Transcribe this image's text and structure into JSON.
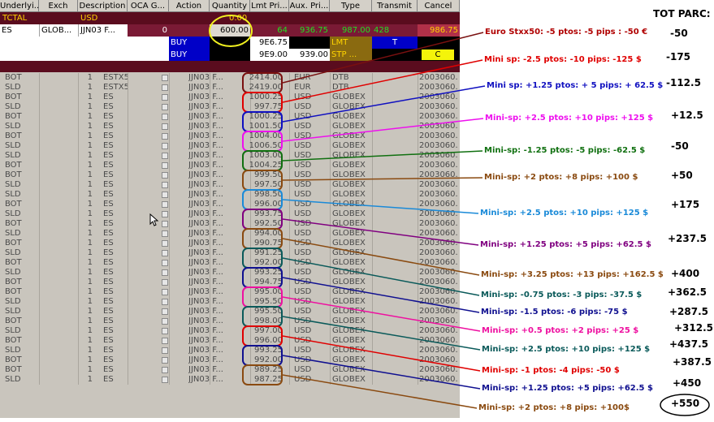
{
  "headers": [
    "Underlyi...",
    "Exch",
    "Description",
    "OCA G...",
    "Action",
    "Quantity",
    "Lmt Pri...",
    "Aux. Pri...",
    "Type",
    "Transmit",
    "Cancel"
  ],
  "total_row": {
    "label": "TCTAL",
    "currency": "USD",
    "value": "0.00"
  },
  "position_row": {
    "underlying": "ES",
    "exch": "GLOB...",
    "desc": "JJN03 F...",
    "oca": "0",
    "quantity": "600.00",
    "v1": "64",
    "v2": "936.75",
    "v3": "987.00",
    "v4": "428",
    "v5": "986.75"
  },
  "order_row_1": {
    "action": "BUY",
    "lmt": "9E6.75",
    "type": "LMT",
    "transmit": "T"
  },
  "order_row_2": {
    "action": "BUY",
    "lmt": "9E9.00",
    "aux": "939.00",
    "type": "STP ...",
    "cancel": "C"
  },
  "trades": [
    {
      "side": "BOT",
      "qty": "1",
      "sym": "ESTX50",
      "desc": "JJN03 F...",
      "price": "2414.00",
      "cur": "EUR",
      "type": "DTB",
      "date": "2003060..."
    },
    {
      "side": "SLD",
      "qty": "1",
      "sym": "ESTX50",
      "desc": "JJN03 F...",
      "price": "2419.00",
      "cur": "EUR",
      "type": "DTB",
      "date": "2003060..."
    },
    {
      "side": "BOT",
      "qty": "1",
      "sym": "ES",
      "desc": "JJN03 F...",
      "price": "1000.25",
      "cur": "USD",
      "type": "GLOBEX",
      "date": "2003060..."
    },
    {
      "side": "SLD",
      "qty": "1",
      "sym": "ES",
      "desc": "JJN03 F...",
      "price": "997.75",
      "cur": "USD",
      "type": "GLOBEX",
      "date": "2003060..."
    },
    {
      "side": "BOT",
      "qty": "1",
      "sym": "ES",
      "desc": "JJN03 F...",
      "price": "1000.25",
      "cur": "USD",
      "type": "GLOBEX",
      "date": "2003060..."
    },
    {
      "side": "SLD",
      "qty": "1",
      "sym": "ES",
      "desc": "JJN03 F...",
      "price": "1001.50",
      "cur": "USD",
      "type": "GLOBEX",
      "date": "2003060..."
    },
    {
      "side": "BOT",
      "qty": "1",
      "sym": "ES",
      "desc": "JJN03 F...",
      "price": "1004.00",
      "cur": "USD",
      "type": "GLOBEX",
      "date": "2003060..."
    },
    {
      "side": "SLD",
      "qty": "1",
      "sym": "ES",
      "desc": "JJN03 F...",
      "price": "1006.50",
      "cur": "USD",
      "type": "GLOBEX",
      "date": "2003060..."
    },
    {
      "side": "SLD",
      "qty": "1",
      "sym": "ES",
      "desc": "JJN03 F...",
      "price": "1003.00",
      "cur": "USD",
      "type": "GLOBEX",
      "date": "2003060..."
    },
    {
      "side": "BOT",
      "qty": "1",
      "sym": "ES",
      "desc": "JJN03 F...",
      "price": "1004.25",
      "cur": "USD",
      "type": "GLOBEX",
      "date": "2003060..."
    },
    {
      "side": "BOT",
      "qty": "1",
      "sym": "ES",
      "desc": "JJN03 F...",
      "price": "999.50",
      "cur": "USD",
      "type": "GLOBEX",
      "date": "2003060..."
    },
    {
      "side": "SLD",
      "qty": "1",
      "sym": "ES",
      "desc": "JJN03 F...",
      "price": "997.50",
      "cur": "USD",
      "type": "GLOBEX",
      "date": "2003060..."
    },
    {
      "side": "SLD",
      "qty": "1",
      "sym": "ES",
      "desc": "JJN03 F...",
      "price": "998.50",
      "cur": "USD",
      "type": "GLOBEX",
      "date": "2003060..."
    },
    {
      "side": "BOT",
      "qty": "1",
      "sym": "ES",
      "desc": "JJN03 F...",
      "price": "996.00",
      "cur": "USD",
      "type": "GLOBEX",
      "date": "2003060..."
    },
    {
      "side": "SLD",
      "qty": "1",
      "sym": "ES",
      "desc": "JJN03 F...",
      "price": "993.75",
      "cur": "USD",
      "type": "GLOBEX",
      "date": "2003060..."
    },
    {
      "side": "BOT",
      "qty": "1",
      "sym": "ES",
      "desc": "JJN03 F...",
      "price": "992.50",
      "cur": "USD",
      "type": "GLOBEX",
      "date": "2003060..."
    },
    {
      "side": "SLD",
      "qty": "1",
      "sym": "ES",
      "desc": "JJN03 F...",
      "price": "994.00",
      "cur": "USD",
      "type": "GLOBEX",
      "date": "2003060..."
    },
    {
      "side": "BOT",
      "qty": "1",
      "sym": "ES",
      "desc": "JJN03 F...",
      "price": "990.75",
      "cur": "USD",
      "type": "GLOBEX",
      "date": "2003060..."
    },
    {
      "side": "SLD",
      "qty": "1",
      "sym": "ES",
      "desc": "JJN03 F...",
      "price": "991.25",
      "cur": "USD",
      "type": "GLOBEX",
      "date": "2003060..."
    },
    {
      "side": "BOT",
      "qty": "1",
      "sym": "ES",
      "desc": "JJN03 F...",
      "price": "992.00",
      "cur": "USD",
      "type": "GLOBEX",
      "date": "2003060..."
    },
    {
      "side": "SLD",
      "qty": "1",
      "sym": "ES",
      "desc": "JJN03 F...",
      "price": "993.25",
      "cur": "USD",
      "type": "GLOBEX",
      "date": "2003060..."
    },
    {
      "side": "BOT",
      "qty": "1",
      "sym": "ES",
      "desc": "JJN03 F...",
      "price": "994.75",
      "cur": "USD",
      "type": "GLOBEX",
      "date": "2003060..."
    },
    {
      "side": "BOT",
      "qty": "1",
      "sym": "ES",
      "desc": "JJN03 F...",
      "price": "995.00",
      "cur": "USD",
      "type": "GLOBEX",
      "date": "2003060..."
    },
    {
      "side": "SLD",
      "qty": "1",
      "sym": "ES",
      "desc": "JJN03 F...",
      "price": "995.50",
      "cur": "USD",
      "type": "GLOBEX",
      "date": "2003060..."
    },
    {
      "side": "SLD",
      "qty": "1",
      "sym": "ES",
      "desc": "JJN03 F...",
      "price": "995.50",
      "cur": "USD",
      "type": "GLOBEX",
      "date": "2003060..."
    },
    {
      "side": "BOT",
      "qty": "1",
      "sym": "ES",
      "desc": "JJN03 F...",
      "price": "998.00",
      "cur": "USD",
      "type": "GLOBEX",
      "date": "2003060..."
    },
    {
      "side": "SLD",
      "qty": "1",
      "sym": "ES",
      "desc": "JJN03 F...",
      "price": "997.00",
      "cur": "USD",
      "type": "GLOBEX",
      "date": "2003060..."
    },
    {
      "side": "BOT",
      "qty": "1",
      "sym": "ES",
      "desc": "JJN03 F...",
      "price": "996.00",
      "cur": "USD",
      "type": "GLOBEX",
      "date": "2003060..."
    },
    {
      "side": "SLD",
      "qty": "1",
      "sym": "ES",
      "desc": "JJN03 F...",
      "price": "993.25",
      "cur": "USD",
      "type": "GLOBEX",
      "date": "2003060..."
    },
    {
      "side": "BOT",
      "qty": "1",
      "sym": "ES",
      "desc": "JJN03 F...",
      "price": "992.00",
      "cur": "USD",
      "type": "GLOBEX",
      "date": "2003060..."
    },
    {
      "side": "BOT",
      "qty": "1",
      "sym": "ES",
      "desc": "JJN03 F...",
      "price": "989.25",
      "cur": "USD",
      "type": "GLOBEX",
      "date": "2003060..."
    },
    {
      "side": "SLD",
      "qty": "1",
      "sym": "ES",
      "desc": "JJN03 F...",
      "price": "987.25",
      "cur": "USD",
      "type": "GLOBEX",
      "date": "2003060..."
    }
  ],
  "annotations": [
    {
      "text": "Euro Stxx50: -5 ptos: -5 pips : -50 €",
      "color": "#b00000"
    },
    {
      "text": "Mini sp: -2.5 ptos: -10 pips: -125 $",
      "color": "#e00000"
    },
    {
      "text": "Mini sp: +1.25 ptos: + 5 pips: + 62.5 $",
      "color": "#1010c0"
    },
    {
      "text": "Mini-sp: +2.5 ptos: +10 pips: +125 $",
      "color": "#ee10ee"
    },
    {
      "text": "Mini-sp: -1.25 ptos: -5 pips: -62.5 $",
      "color": "#107010"
    },
    {
      "text": "Mini-sp: +2 ptos: +8 pips: +100 $",
      "color": "#8a4a10"
    },
    {
      "text": "Mini-sp: +2.5 ptos: +10 pips: +125 $",
      "color": "#1a8ad8"
    },
    {
      "text": "Mini-sp: +1.25 ptos: +5 pips: +62.5 $",
      "color": "#800080"
    },
    {
      "text": "Mini-sp: +3.25 ptos: +13 pips: +162.5 $",
      "color": "#8a4a10"
    },
    {
      "text": "Mini-sp: -0.75 ptos: -3 pips: -37.5 $",
      "color": "#0a5a5a"
    },
    {
      "text": "Mini-sp: -1.5 ptos: -6 pips: -75 $",
      "color": "#101090"
    },
    {
      "text": "Mini-sp: +0.5 ptos: +2 pips: +25 $",
      "color": "#ee10a0"
    },
    {
      "text": "Mini-sp: +2.5 ptos: +10 pips: +125 $",
      "color": "#0a5a5a"
    },
    {
      "text": "Mini-sp: -1 ptos: -4 pips: -50 $",
      "color": "#e00000"
    },
    {
      "text": "Mini-sp: +1.25 ptos: +5 pips: +62.5 $",
      "color": "#101090"
    },
    {
      "text": "Mini-sp: +2 ptos: +8 pips: +100$",
      "color": "#8a4a10"
    }
  ],
  "totals": {
    "title": "TOT PARC:",
    "values": [
      "-50",
      "-175",
      "-112.5",
      "+12.5",
      "-50",
      "+50",
      "+175",
      "+237.5",
      "+400",
      "+362.5",
      "+287.5",
      "+312.5",
      "+437.5",
      "+387.5",
      "+450",
      "+550"
    ]
  }
}
